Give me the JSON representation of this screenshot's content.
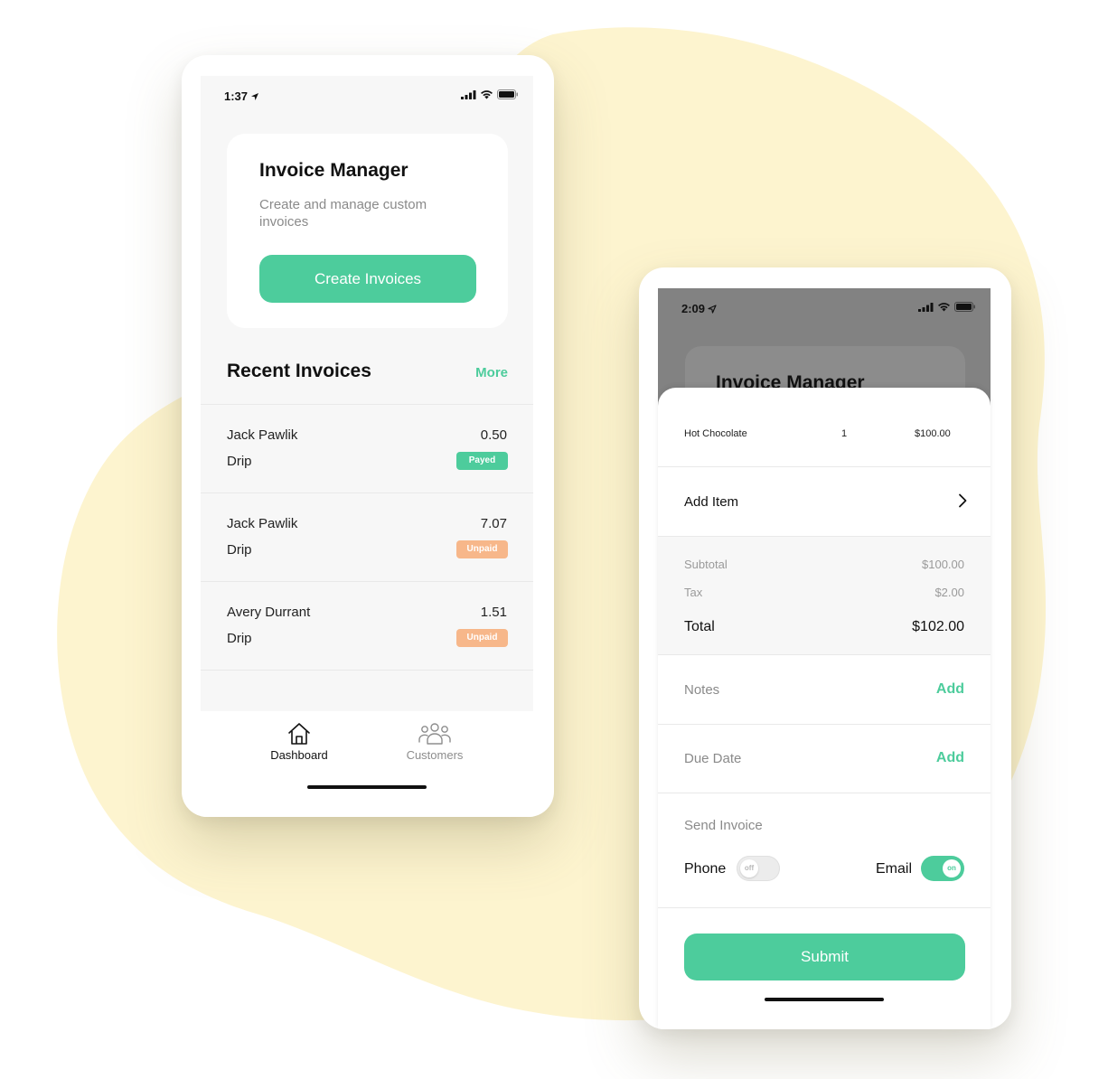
{
  "colors": {
    "accent": "#4dcc9c",
    "unpaid": "#f7b78a",
    "backdrop_blob": "#fdf4cf"
  },
  "dashboard_phone": {
    "status_time": "1:37",
    "intro_card": {
      "title": "Invoice Manager",
      "subtitle": "Create and manage custom invoices",
      "button_label": "Create Invoices"
    },
    "recent": {
      "title": "Recent Invoices",
      "more_label": "More"
    },
    "invoices": [
      {
        "name": "Jack Pawlik",
        "amount": "0.50",
        "item": "Drip",
        "status": "Payed"
      },
      {
        "name": "Jack Pawlik",
        "amount": "7.07",
        "item": "Drip",
        "status": "Unpaid"
      },
      {
        "name": "Avery Durrant",
        "amount": "1.51",
        "item": "Drip",
        "status": "Unpaid"
      }
    ],
    "tabbar": {
      "dashboard": {
        "label": "Dashboard",
        "icon": "home-icon"
      },
      "customers": {
        "label": "Customers",
        "icon": "users-icon"
      }
    }
  },
  "invoice_phone": {
    "status_time": "2:09",
    "background_title": "Invoice Manager",
    "line_item": {
      "name": "Hot Chocolate",
      "qty": "1",
      "price": "$100.00"
    },
    "add_item_label": "Add Item",
    "totals": {
      "subtotal_label": "Subtotal",
      "subtotal_value": "$100.00",
      "tax_label": "Tax",
      "tax_value": "$2.00",
      "total_label": "Total",
      "total_value": "$102.00"
    },
    "notes": {
      "label": "Notes",
      "action": "Add"
    },
    "due_date": {
      "label": "Due Date",
      "action": "Add"
    },
    "send": {
      "title": "Send Invoice",
      "phone_label": "Phone",
      "phone_state": "off",
      "email_label": "Email",
      "email_state": "on"
    },
    "submit_label": "Submit"
  }
}
